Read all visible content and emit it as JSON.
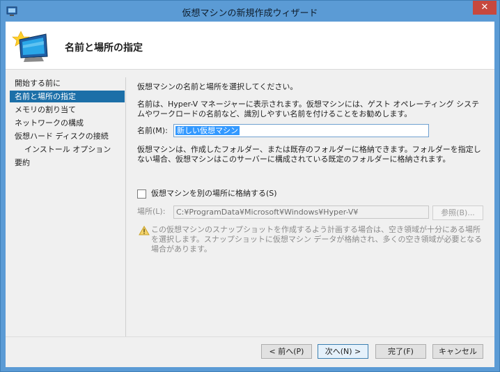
{
  "window": {
    "title": "仮想マシンの新規作成ウィザード",
    "close_symbol": "✕"
  },
  "header": {
    "title": "名前と場所の指定",
    "icon": "new-vm-icon"
  },
  "nav": {
    "items": [
      {
        "label": "開始する前に"
      },
      {
        "label": "名前と場所の指定",
        "selected": true
      },
      {
        "label": "メモリの割り当て"
      },
      {
        "label": "ネットワークの構成"
      },
      {
        "label": "仮想ハード ディスクの接続"
      },
      {
        "label": "インストール オプション"
      },
      {
        "label": "要約"
      }
    ]
  },
  "content": {
    "intro": "仮想マシンの名前と場所を選択してください。",
    "description": "名前は、Hyper-V マネージャーに表示されます。仮想マシンには、ゲスト オペレーティング システムやワークロードの名前など、識別しやすい名前を付けることをお勧めします。",
    "name_label": "名前(M):",
    "name_value": "新しい仮想マシン",
    "folder_description": "仮想マシンは、作成したフォルダー、または既存のフォルダーに格納できます。フォルダーを指定しない場合、仮想マシンはこのサーバーに構成されている既定のフォルダーに格納されます。",
    "checkbox_label": "仮想マシンを別の場所に格納する(S)",
    "checkbox_checked": false,
    "location_label": "場所(L):",
    "location_value": "C:¥ProgramData¥Microsoft¥Windows¥Hyper-V¥",
    "browse_label": "参照(B)...",
    "warning_text": "この仮想マシンのスナップショットを作成するよう計画する場合は、空き領域が十分にある場所を選択します。スナップショットに仮想マシン データが格納され、多くの空き領域が必要となる場合があります。"
  },
  "footer": {
    "back_label": "< 前へ(P)",
    "next_label": "次へ(N) >",
    "finish_label": "完了(F)",
    "cancel_label": "キャンセル"
  },
  "colors": {
    "titlebar": "#5b9bd5",
    "selection": "#1c6fa8",
    "close": "#c7483e"
  }
}
